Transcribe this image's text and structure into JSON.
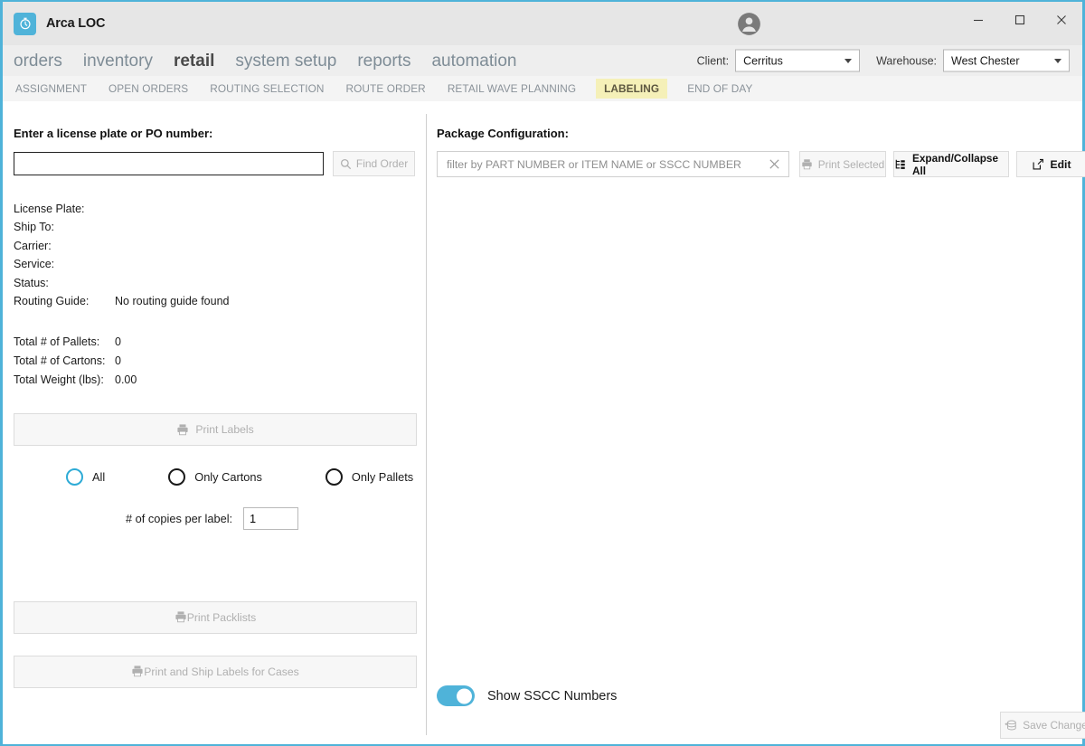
{
  "window": {
    "app_title": "Arca LOC",
    "logo_icon": "stopwatch-icon",
    "avatar_icon": "user-account-icon",
    "minimize_label": "─",
    "maximize_label": "□",
    "close_label": "✕"
  },
  "main_nav": {
    "items": [
      {
        "label": "orders",
        "active": false
      },
      {
        "label": "inventory",
        "active": false
      },
      {
        "label": "retail",
        "active": true
      },
      {
        "label": "system setup",
        "active": false
      },
      {
        "label": "reports",
        "active": false
      },
      {
        "label": "automation",
        "active": false
      }
    ]
  },
  "context": {
    "client_label": "Client:",
    "client_value": "Cerritus",
    "warehouse_label": "Warehouse:",
    "warehouse_value": "West Chester"
  },
  "sub_nav": {
    "items": [
      {
        "label": "ASSIGNMENT",
        "active": false
      },
      {
        "label": "OPEN ORDERS",
        "active": false
      },
      {
        "label": "ROUTING SELECTION",
        "active": false
      },
      {
        "label": "ROUTE ORDER",
        "active": false
      },
      {
        "label": "RETAIL WAVE PLANNING",
        "active": false
      },
      {
        "label": "LABELING",
        "active": true
      },
      {
        "label": "END OF DAY",
        "active": false
      }
    ]
  },
  "left_panel": {
    "heading": "Enter a license plate or PO number:",
    "search_value": "",
    "search_placeholder": "",
    "find_order_label": "Find Order",
    "find_order_icon": "search-icon",
    "details": [
      {
        "key": "License Plate:",
        "value": ""
      },
      {
        "key": "Ship To:",
        "value": ""
      },
      {
        "key": "Carrier:",
        "value": ""
      },
      {
        "key": "Service:",
        "value": ""
      },
      {
        "key": "Status:",
        "value": ""
      },
      {
        "key": "Routing Guide:",
        "value": "No routing guide found"
      }
    ],
    "totals": [
      {
        "key": "Total # of Pallets:",
        "value": "0"
      },
      {
        "key": "Total # of Cartons:",
        "value": "0"
      },
      {
        "key": "Total Weight (lbs):",
        "value": "0.00"
      }
    ],
    "print_labels_label": "Print Labels",
    "print_labels_icon": "printer-icon",
    "radio_options": [
      {
        "label": "All",
        "selected": true
      },
      {
        "label": "Only Cartons",
        "selected": false
      },
      {
        "label": "Only Pallets",
        "selected": false
      }
    ],
    "copies_label": "# of copies per label:",
    "copies_value": "1",
    "print_packlists_label": "Print Packlists",
    "print_packlists_icon": "printer-icon",
    "print_ship_labels_label": "Print and Ship Labels for Cases",
    "print_ship_labels_icon": "printer-icon"
  },
  "right_panel": {
    "heading": "Package Configuration:",
    "filter_value": "",
    "filter_placeholder": "filter by PART NUMBER or ITEM NAME or SSCC NUMBER",
    "clear_icon": "close-x-icon",
    "print_selected_label": "Print Selected",
    "print_selected_icon": "printer-icon",
    "expand_collapse_label": "Expand/Collapse All",
    "expand_collapse_icon": "tree-expand-icon",
    "edit_label": "Edit",
    "edit_icon": "pencil-edit-icon",
    "toggle_label": "Show SSCC Numbers",
    "toggle_on": true,
    "save_changes_label": "Save Changes",
    "save_changes_icon": "database-save-icon"
  },
  "colors": {
    "accent": "#4fb3d9",
    "radio_selected": "#2eabd6",
    "tab_highlight": "#f5f0b8",
    "titlebar_bg": "#e6e6e6",
    "nav_bg": "#eeeeee",
    "subnav_bg": "#f4f4f4"
  }
}
